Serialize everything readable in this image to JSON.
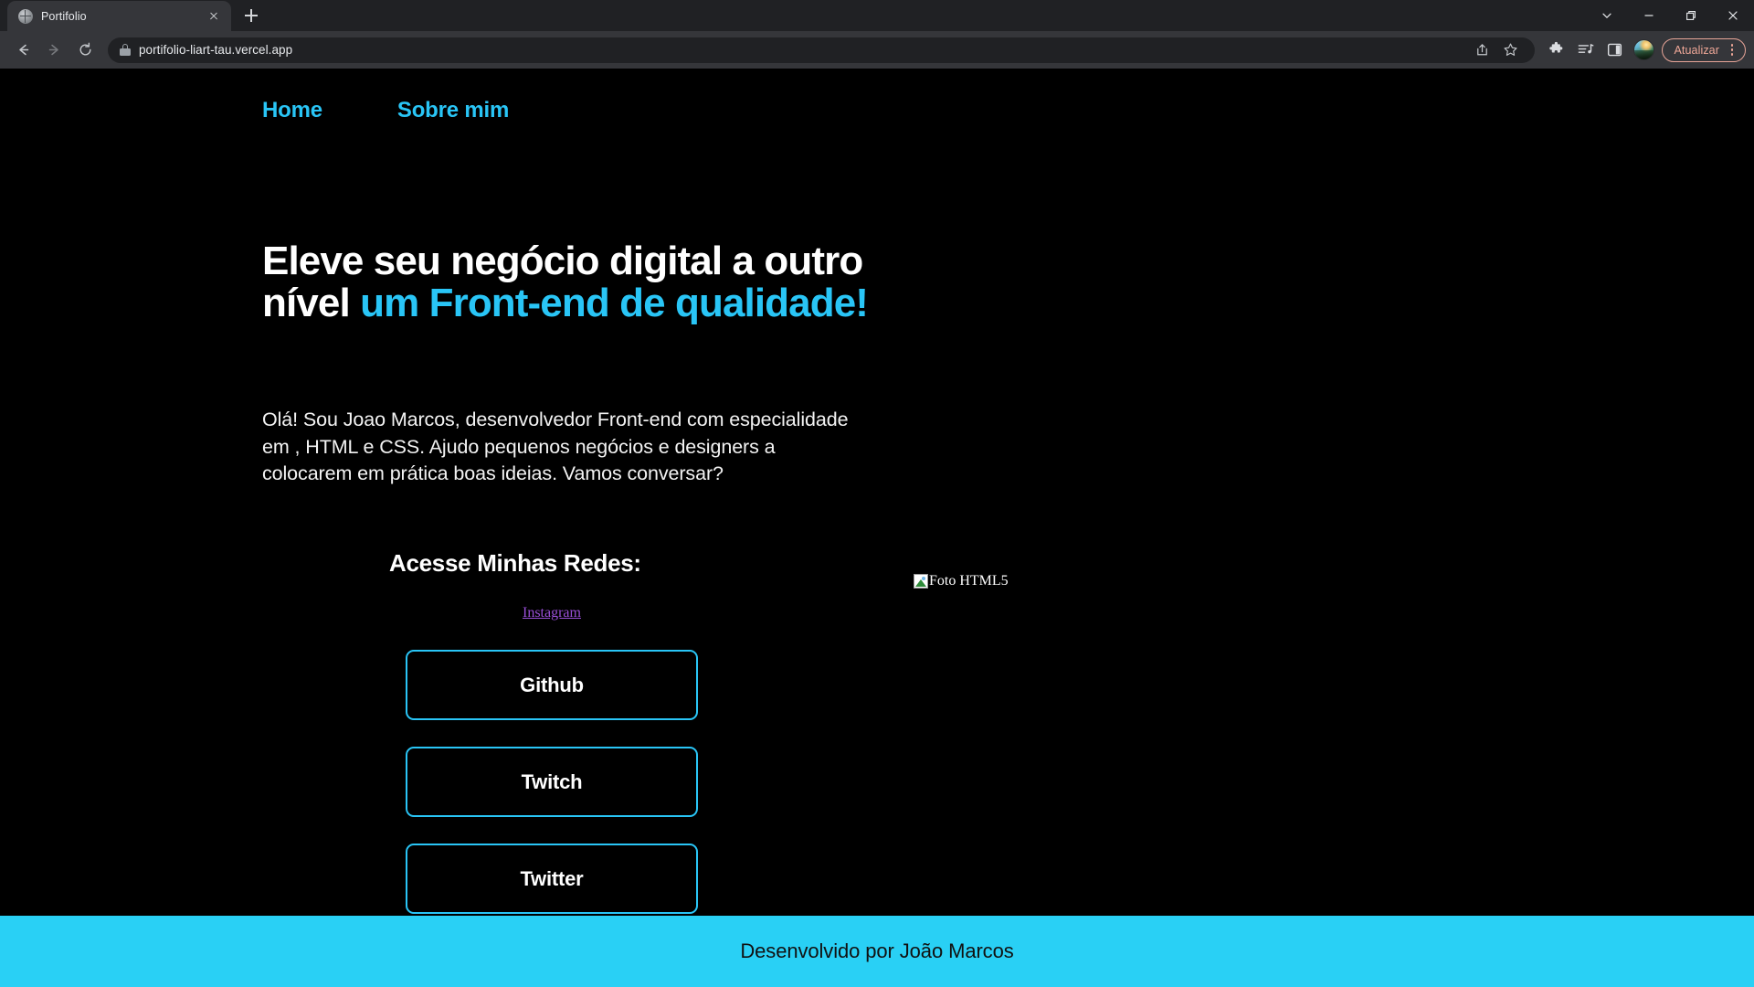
{
  "browser": {
    "tab": {
      "title": "Portifolio",
      "favicon": "globe-icon",
      "close_label": "×"
    },
    "new_tab_label": "+",
    "window_controls": {
      "dropdown": "chevron-down-icon",
      "minimize": "minimize-icon",
      "maximize": "restore-icon",
      "close": "close-icon"
    },
    "nav": {
      "back": "back-arrow-icon",
      "forward": "forward-arrow-icon",
      "reload": "reload-icon"
    },
    "omnibox": {
      "url": "portifolio-liart-tau.vercel.app",
      "security": "lock-icon",
      "share": "share-icon",
      "bookmark": "star-icon"
    },
    "toolbar_icons": {
      "extensions": "puzzle-icon",
      "media": "media-list-icon",
      "side_panel": "side-panel-icon"
    },
    "profile": {
      "avatar": "user-avatar",
      "update_label": "Atualizar",
      "menu": "kebab-menu-icon"
    }
  },
  "page": {
    "nav_links": [
      {
        "label": "Home"
      },
      {
        "label": "Sobre mim"
      }
    ],
    "hero": {
      "heading_part1": "Eleve seu negócio digital a outro nível ",
      "heading_accent": "um Front-end de qualidade!",
      "paragraph": "Olá! Sou Joao Marcos, desenvolvedor Front-end com especialidade em , HTML e CSS. Ajudo pequenos negócios e designers a colocarem em prática boas ideias. Vamos conversar?"
    },
    "social": {
      "heading": "Acesse Minhas Redes:",
      "instagram_label": " Instagram",
      "buttons": [
        {
          "label": "Github"
        },
        {
          "label": "Twitch"
        },
        {
          "label": "Twitter"
        }
      ]
    },
    "image": {
      "alt_text": "Foto HTML5"
    },
    "footer": {
      "text": "Desenvolvido por João Marcos"
    },
    "colors": {
      "background": "#000000",
      "accent_cyan": "#29c5f6",
      "footer_bg": "#29d0f5",
      "text_white": "#ffffff",
      "link_purple": "#9a4fd8"
    }
  }
}
